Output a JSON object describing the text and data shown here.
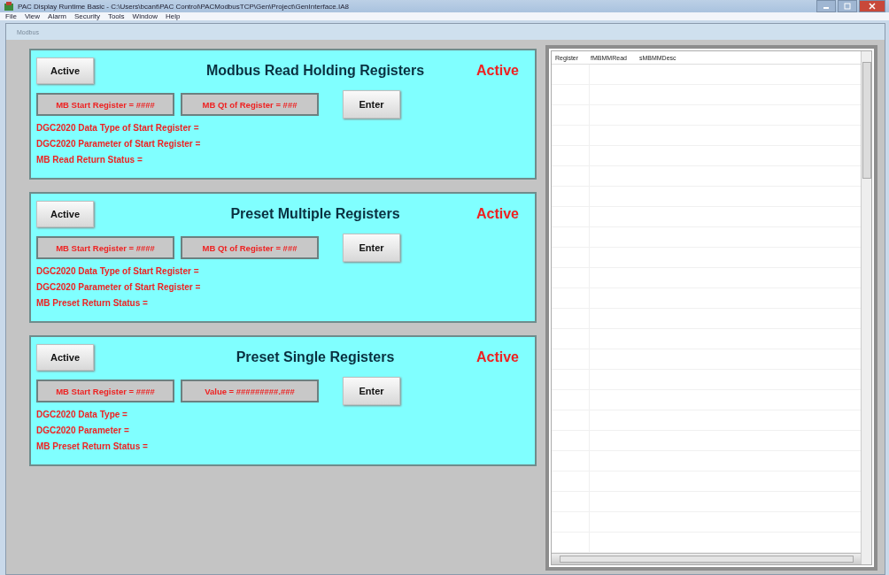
{
  "window": {
    "title": "PAC Display Runtime Basic - C:\\Users\\bcant\\PAC Control\\PACModbusTCP\\Gen\\Project\\GenInterface.IA8"
  },
  "menu": [
    "File",
    "View",
    "Alarm",
    "Security",
    "Tools",
    "Window",
    "Help"
  ],
  "child_window": {
    "title": "Modbus"
  },
  "panels": [
    {
      "button": "Active",
      "title": "Modbus Read Holding Registers",
      "status": "Active",
      "fields": [
        "MB Start Register = ####",
        "MB Qt of Register = ###"
      ],
      "enter": "Enter",
      "lines": [
        "DGC2020 Data Type of Start Register =",
        "DGC2020 Parameter of Start Register =",
        "MB Read Return Status ="
      ]
    },
    {
      "button": "Active",
      "title": "Preset Multiple Registers",
      "status": "Active",
      "fields": [
        "MB Start Register = ####",
        "MB Qt of Register = ###"
      ],
      "enter": "Enter",
      "lines": [
        "DGC2020 Data Type of Start Register =",
        "DGC2020 Parameter of Start Register =",
        "MB Preset Return Status ="
      ]
    },
    {
      "button": "Active",
      "title": "Preset Single Registers",
      "status": "Active",
      "fields": [
        "MB Start Register = ####",
        "Value = #########.###"
      ],
      "enter": "Enter",
      "lines": [
        "DGC2020 Data Type =",
        "DGC2020 Parameter =",
        "MB Preset Return Status ="
      ]
    }
  ],
  "table": {
    "columns": [
      "Register",
      "fMBMMRead",
      "sMBMMDesc"
    ]
  }
}
